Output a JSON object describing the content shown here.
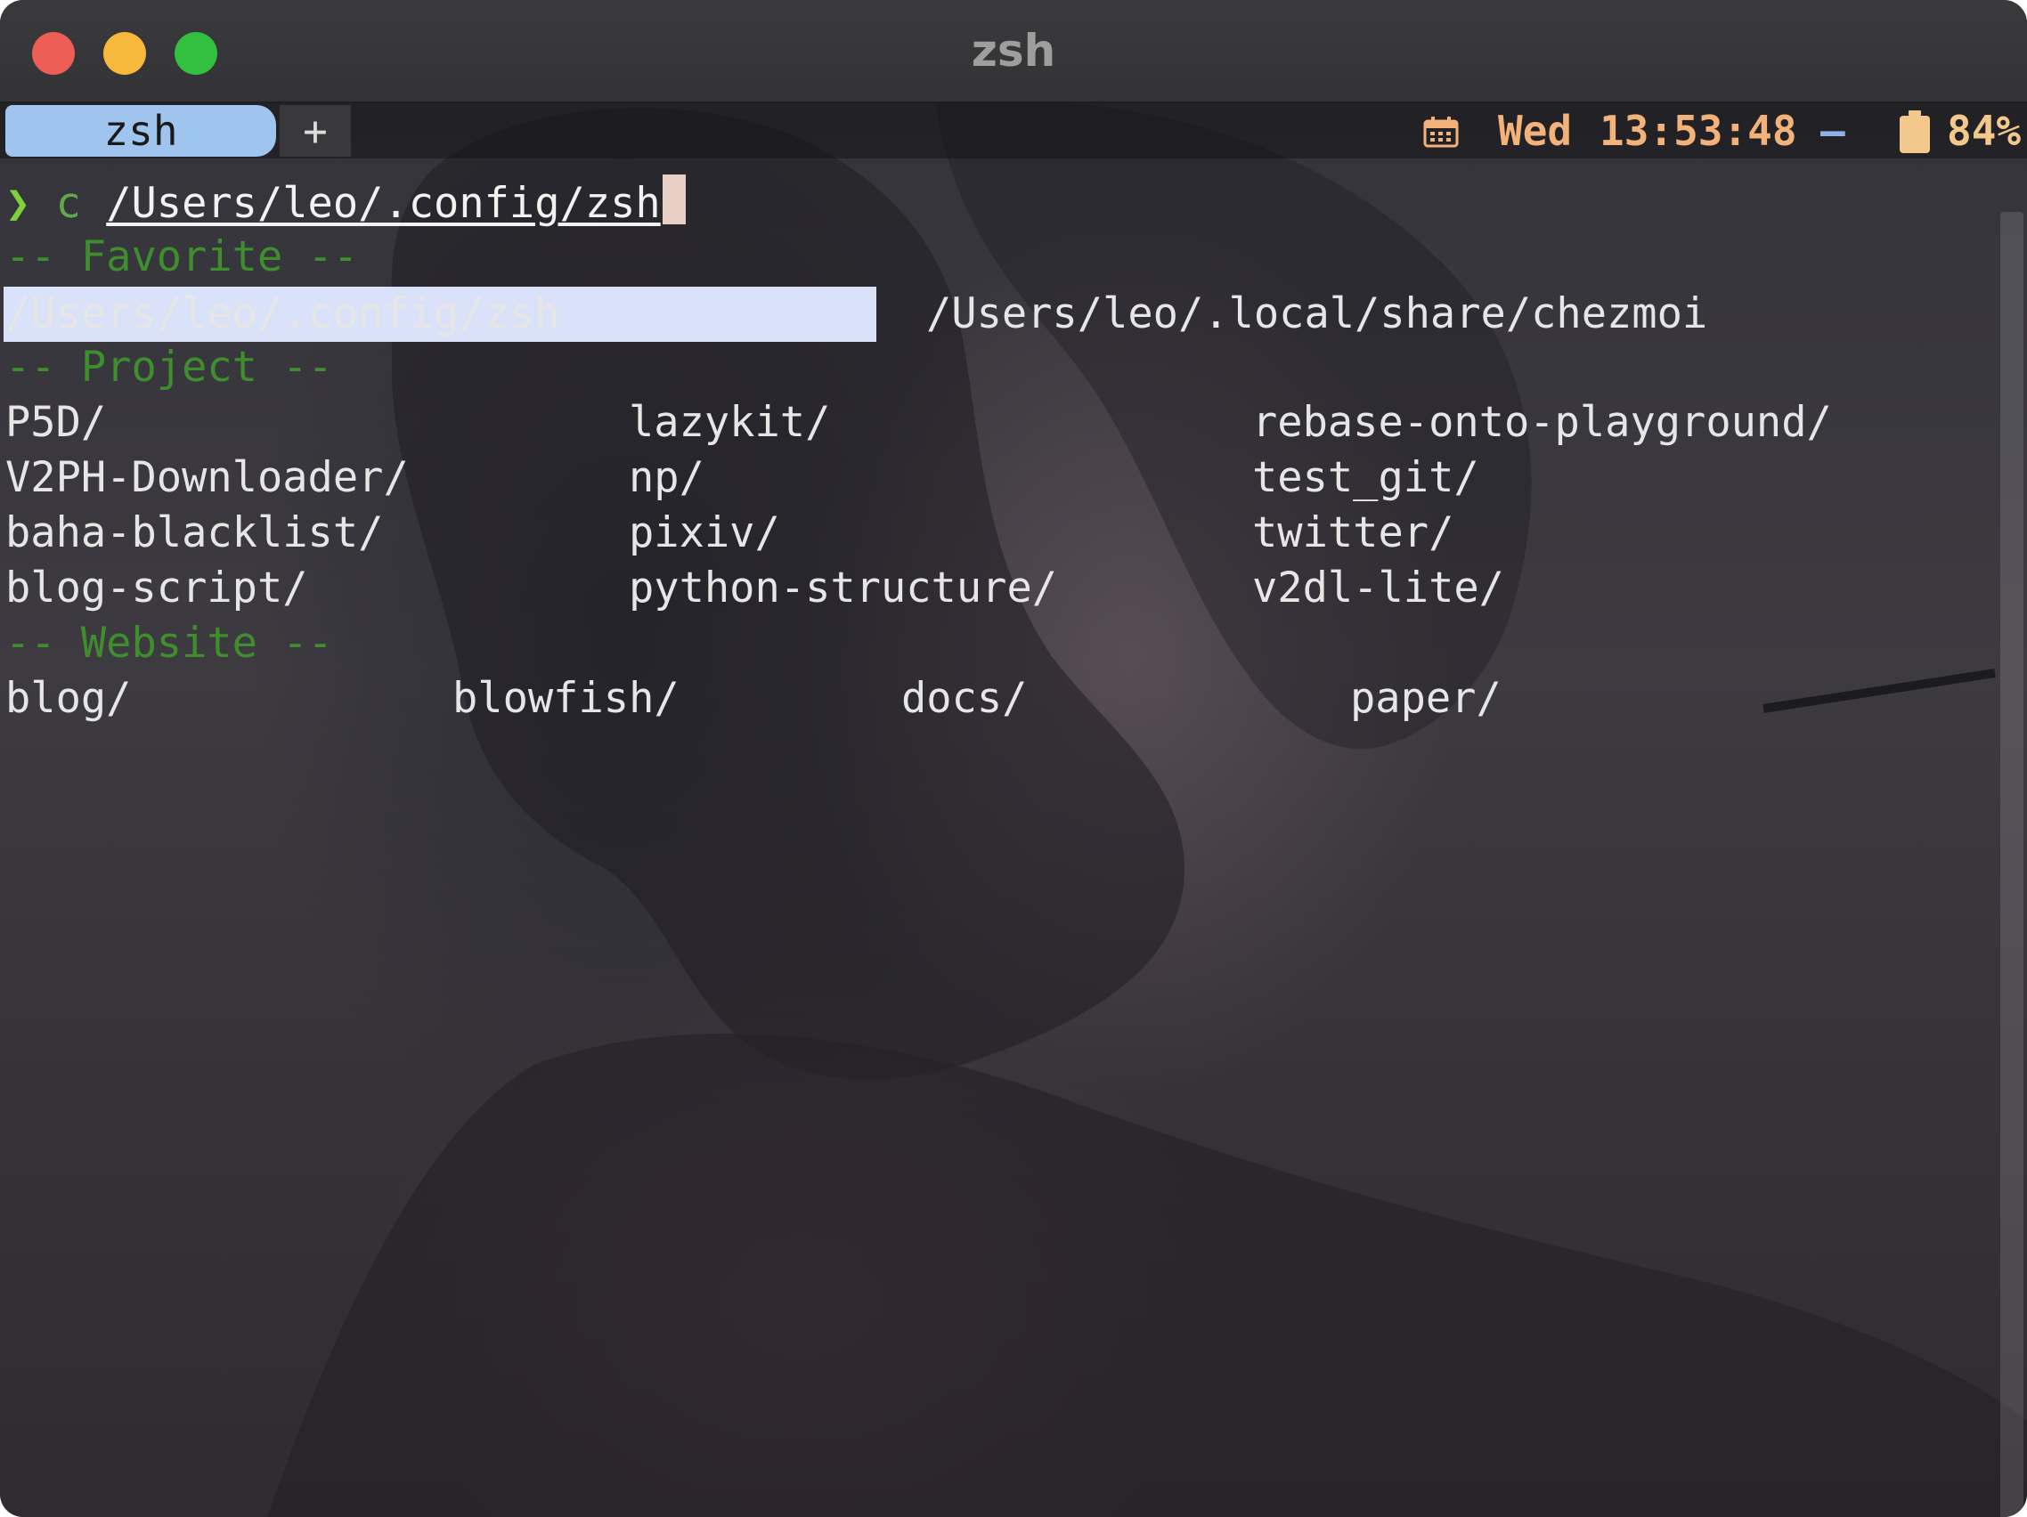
{
  "window": {
    "title": "zsh"
  },
  "tabs": [
    {
      "label": "zsh"
    }
  ],
  "tabbar": {
    "new_tab_label": "+"
  },
  "status": {
    "day": "Wed",
    "time": "13:53:48",
    "separator": "—",
    "battery": "84%"
  },
  "prompt": {
    "symbol": "❯",
    "command": "c",
    "argument": "/Users/leo/.config/zsh"
  },
  "sections": {
    "favorite": {
      "heading": "-- Favorite --",
      "items": [
        "/Users/leo/.config/zsh",
        "/Users/leo/.local/share/chezmoi"
      ]
    },
    "project": {
      "heading": "-- Project --",
      "items": [
        "P5D/",
        "lazykit/",
        "rebase-onto-playground/",
        "V2PH-Downloader/",
        "np/",
        "test_git/",
        "baha-blacklist/",
        "pixiv/",
        "twitter/",
        "blog-script/",
        "python-structure/",
        "v2dl-lite/"
      ]
    },
    "website": {
      "heading": "-- Website --",
      "items": [
        "blog/",
        "blowfish/",
        "docs/",
        "paper/"
      ]
    }
  },
  "colors": {
    "accent_tab": "#9fc5ee",
    "prompt_green": "#7fd13b",
    "heading_green": "#3f8e2e",
    "status_orange": "#f2b27a",
    "selection": "#d9e2f8"
  },
  "icons": [
    "calendar-icon",
    "battery-icon"
  ]
}
